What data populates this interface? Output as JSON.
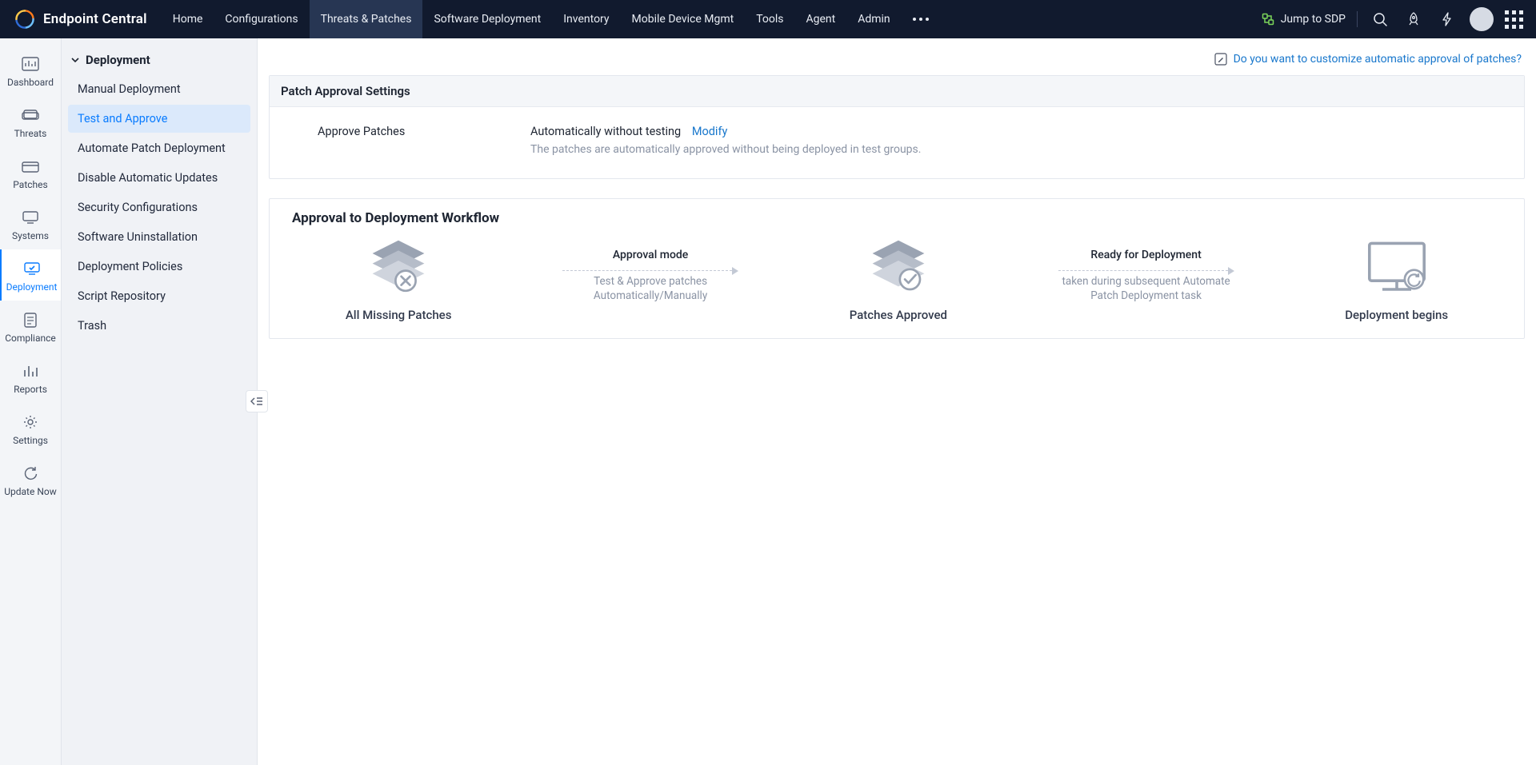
{
  "brand": {
    "name": "Endpoint Central"
  },
  "topnav": {
    "items": [
      "Home",
      "Configurations",
      "Threats & Patches",
      "Software Deployment",
      "Inventory",
      "Mobile Device Mgmt",
      "Tools",
      "Agent",
      "Admin"
    ],
    "activeIndex": 2,
    "jump_label": "Jump to SDP"
  },
  "rail": {
    "items": [
      {
        "label": "Dashboard"
      },
      {
        "label": "Threats"
      },
      {
        "label": "Patches"
      },
      {
        "label": "Systems"
      },
      {
        "label": "Deployment"
      },
      {
        "label": "Compliance"
      },
      {
        "label": "Reports"
      },
      {
        "label": "Settings"
      },
      {
        "label": "Update Now"
      }
    ],
    "activeIndex": 4
  },
  "sidepanel": {
    "header": "Deployment",
    "items": [
      "Manual Deployment",
      "Test and Approve",
      "Automate Patch Deployment",
      "Disable Automatic Updates",
      "Security Configurations",
      "Software Uninstallation",
      "Deployment Policies",
      "Script Repository",
      "Trash"
    ],
    "activeIndex": 1
  },
  "top_link": "Do you want to customize automatic approval of patches?",
  "approval_card": {
    "title": "Patch Approval Settings",
    "row_label": "Approve Patches",
    "value": "Automatically without testing",
    "modify": "Modify",
    "desc": "The patches are automatically approved without being deployed in test groups."
  },
  "workflow": {
    "title": "Approval to Deployment Workflow",
    "node1": "All Missing Patches",
    "step1_title": "Approval mode",
    "step1_desc": "Test & Approve patches Automatically/Manually",
    "node2": "Patches Approved",
    "step2_title": "Ready for Deployment",
    "step2_desc": "taken during subsequent Automate Patch Deployment task",
    "node3": "Deployment begins"
  }
}
